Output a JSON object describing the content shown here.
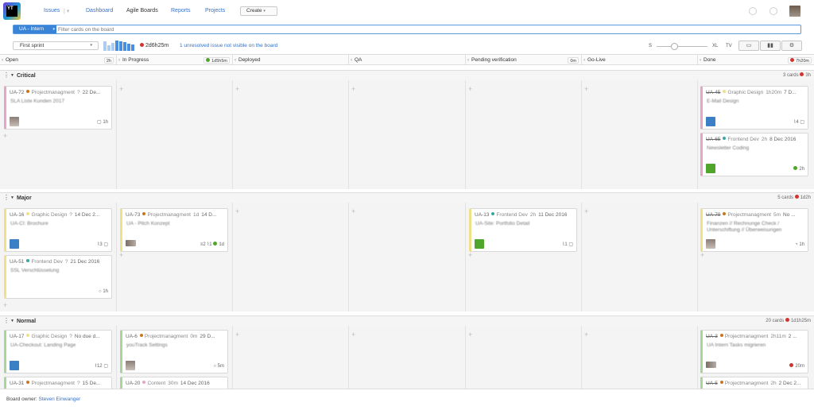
{
  "nav": {
    "issues": "Issues",
    "dashboard": "Dashboard",
    "agile_boards": "Agile Boards",
    "reports": "Reports",
    "projects": "Projects",
    "create": "Create",
    "logo_text": "YT"
  },
  "search": {
    "board": "UA - Intern",
    "placeholder": "Filter cards on the board"
  },
  "sprint": {
    "name": "First sprint",
    "time_left": "2d6h25m",
    "unresolved_notice": "1 unresolved issue not visible on the board",
    "burndown_levels": [
      0.9,
      0.55,
      0.75,
      1.0,
      0.95,
      0.85,
      0.7,
      0.6
    ]
  },
  "zoom": {
    "s": "S",
    "xl": "XL",
    "tv": "TV",
    "level": 0.35
  },
  "columns": [
    {
      "name": "Open",
      "badge": "2h"
    },
    {
      "name": "In Progress",
      "badge": "1d5h5m"
    },
    {
      "name": "Deployed",
      "badge": ""
    },
    {
      "name": "QA",
      "badge": ""
    },
    {
      "name": "Pending verification",
      "badge": "0m"
    },
    {
      "name": "Go-Live",
      "badge": ""
    },
    {
      "name": "Done",
      "badge": "7h20m"
    }
  ],
  "lanes": {
    "critical": {
      "name": "Critical",
      "count": "3 cards",
      "time": "3h"
    },
    "major": {
      "name": "Major",
      "count": "5 cards",
      "time": "1d2h"
    },
    "normal": {
      "name": "Normal",
      "count": "20 cards",
      "time": "1d1h25m"
    }
  },
  "cards": {
    "ua72": {
      "id": "UA-72",
      "tag": "Projectmanagment",
      "est": "?",
      "date": "22 De...",
      "summary": "SLA Liste Kunden 2017",
      "foot": "1h"
    },
    "ua45": {
      "id": "UA-45",
      "tag": "Graphic Design",
      "est": "1h20m",
      "date": "7 D...",
      "summary": "E-Mail Design",
      "foot": "4"
    },
    "ua65": {
      "id": "UA-65",
      "tag": "Frontend Dev",
      "est": "2h",
      "date": "8 Dec 2016",
      "summary": "Newsletter Coding",
      "foot": "2h"
    },
    "ua16": {
      "id": "UA-16",
      "tag": "Graphic Design",
      "est": "?",
      "date": "14 Dec 2...",
      "summary": "UA-CI: Brochure",
      "foot": "3"
    },
    "ua73": {
      "id": "UA-73",
      "tag": "Projectmanagment",
      "est": "1d",
      "date": "14 D...",
      "summary": "UA - Pitch Konzept",
      "foot_a": "2",
      "foot_b": "1",
      "foot_c": "1d"
    },
    "ua13": {
      "id": "UA-13",
      "tag": "Frontend Dev",
      "est": "2h",
      "date": "11 Dec 2016",
      "summary": "UA-Site: Portfolio Detail",
      "foot": "1"
    },
    "ua79": {
      "id": "UA-79",
      "tag": "Projectmanagment",
      "est": "5m",
      "date": "No ...",
      "summary": "Finanzen // Rechnunge Check / Unterschiftung // Überweisungen",
      "foot": "1h"
    },
    "ua51": {
      "id": "UA-51",
      "tag": "Frontend Dev",
      "est": "?",
      "date": "21 Dec 2016",
      "summary": "SSL Verschlüsselung",
      "foot": "1h"
    },
    "ua17": {
      "id": "UA-17",
      "tag": "Graphic Design",
      "est": "?",
      "date": "No due d...",
      "summary": "UA-Checkout: Landing Page",
      "foot": "12"
    },
    "ua6": {
      "id": "UA-6",
      "tag": "Projectmanagment",
      "est": "0m",
      "date": "29 D...",
      "summary": "youTrack Settings",
      "foot": "5m"
    },
    "ua3": {
      "id": "UA-3",
      "tag": "Projectmanagment",
      "est": "2h11m",
      "date": "2 ...",
      "summary": "UA Intern Tasks migrieren",
      "foot": "20m"
    },
    "ua31": {
      "id": "UA-31",
      "tag": "Projectmanagment",
      "est": "?",
      "date": "15 De..."
    },
    "ua20": {
      "id": "UA-20",
      "tag": "Content",
      "est": "30m",
      "date": "14 Dec 2016"
    },
    "ua5": {
      "id": "UA-5",
      "tag": "Projectmanagment",
      "est": "2h",
      "date": "2 Dec 2..."
    }
  },
  "footer": {
    "label": "Board owner:",
    "owner": "Steven Einwanger"
  },
  "colors": {
    "projectmanagment": "#c9761f",
    "graphic_design": "#f0e08a",
    "frontend_dev": "#3aa6a6",
    "content": "#e8a4c8",
    "accent": "#3a84d8"
  }
}
